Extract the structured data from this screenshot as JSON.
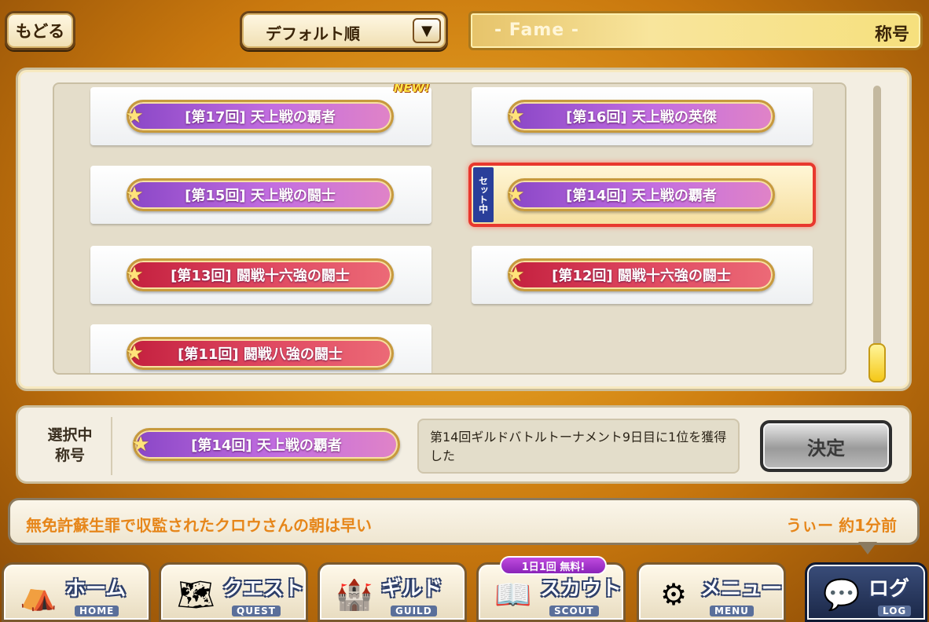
{
  "topbar": {
    "back_label": "もどる",
    "sort_label": "デフォルト順",
    "fame_label": "- Fame -",
    "title_label": "称号"
  },
  "titles": [
    {
      "text": "[第17回] 天上戦の覇者",
      "color": "purple",
      "badge": "NEW!"
    },
    {
      "text": "[第16回] 天上戦の英傑",
      "color": "purple"
    },
    {
      "text": "[第15回] 天上戦の闘士",
      "color": "purple"
    },
    {
      "text": "[第14回] 天上戦の覇者",
      "color": "purple",
      "selected": true,
      "set_tag": "セット中"
    },
    {
      "text": "[第13回] 闘戦十六強の闘士",
      "color": "red"
    },
    {
      "text": "[第12回] 闘戦十六強の闘士",
      "color": "red"
    },
    {
      "text": "[第11回] 闘戦八強の闘士",
      "color": "red"
    }
  ],
  "detail": {
    "selected_label": "選択中\n称号",
    "selected_title": "[第14回] 天上戦の覇者",
    "description": "第14回ギルドバトルトーナメント9日目に1位を獲得した",
    "decide_label": "決定"
  },
  "log": {
    "message": "無免許蘇生罪で収監されたクロウさんの朝は早い",
    "time": "うぃー 約1分前"
  },
  "nav": [
    {
      "label": "ホーム",
      "sub": "HOME",
      "icon": "tent-icon"
    },
    {
      "label": "クエスト",
      "sub": "QUEST",
      "icon": "map-icon"
    },
    {
      "label": "ギルド",
      "sub": "GUILD",
      "icon": "castle-icon"
    },
    {
      "label": "スカウト",
      "sub": "SCOUT",
      "icon": "book-icon"
    },
    {
      "label": "メニュー",
      "sub": "MENU",
      "icon": "gear-icon"
    },
    {
      "label": "ログ",
      "sub": "LOG",
      "icon": "chat-bubble-icon"
    }
  ],
  "free_badge": "1日1回 無料!",
  "colors": {
    "purple_badge": "#a45ad6",
    "red_badge": "#d4354f",
    "selected_outline": "#e8382e",
    "log_text": "#e6861a"
  }
}
